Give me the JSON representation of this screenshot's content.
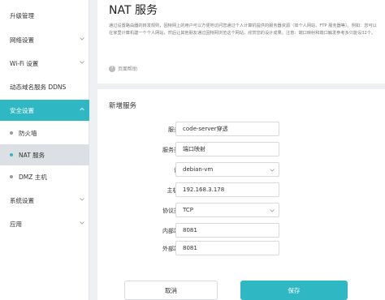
{
  "sidebar": {
    "items": [
      {
        "label": "升级管理"
      },
      {
        "label": "网络设置"
      },
      {
        "label": "Wi-Fi 设置"
      },
      {
        "label": "动态域名服务 DDNS"
      },
      {
        "label": "安全设置"
      },
      {
        "label": "防火墙"
      },
      {
        "label": "NAT 服务"
      },
      {
        "label": "DMZ 主机"
      },
      {
        "label": "系统设置"
      },
      {
        "label": "应用"
      }
    ]
  },
  "header": {
    "title": "NAT 服务",
    "description": "通过设置路由器的转发规则，因特网上的用户可以方便地访问您通过个人计算机提供的服务器资源（如个人网站、FTP 服务器等）。例如：您可以在家里计算机建一个个人网站，然后让其他朋友通过因特网浏览这个网站，欣赏您的设计成果。注意：端口映射和端口触发参考多只能设32个。",
    "help_label": "页面帮助"
  },
  "form": {
    "section_title": "新增服务",
    "fields": {
      "service_name": {
        "label": "服务名",
        "value": "code-server穿透"
      },
      "service_type": {
        "label": "服务类型",
        "value": "端口映射"
      },
      "device": {
        "label": "设备",
        "value": "debian-vm"
      },
      "host_ip": {
        "label": "主机 IP",
        "value": "192.168.3.178"
      },
      "protocol": {
        "label": "协议类型",
        "value": "TCP"
      },
      "internal_port": {
        "label": "内部端口",
        "value": "8081"
      },
      "external_port": {
        "label": "外部端口",
        "value": "8081"
      }
    }
  },
  "buttons": {
    "cancel": "取消",
    "save": "保存"
  },
  "colors": {
    "accent": "#2fb7c4"
  }
}
